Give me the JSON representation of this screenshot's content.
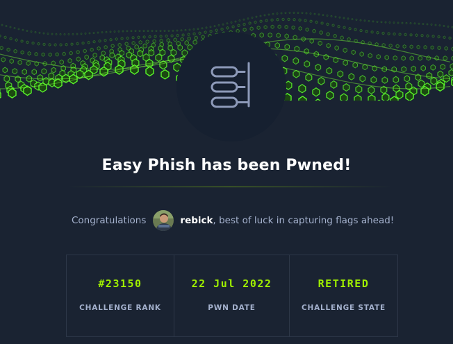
{
  "card": {
    "challenge_name": "Easy Phish",
    "title": "Easy Phish has been Pwned!",
    "congrats_prefix": "Congratulations",
    "username": "rebick",
    "congrats_suffix": ", best of luck in capturing flags ahead!"
  },
  "stats": [
    {
      "value": "#23150",
      "label": "CHALLENGE RANK"
    },
    {
      "value": "22 Jul 2022",
      "label": "PWN DATE"
    },
    {
      "value": "RETIRED",
      "label": "CHALLENGE STATE"
    }
  ],
  "icons": {
    "badge": "database-stack-icon",
    "avatar": "user-avatar"
  },
  "colors": {
    "background": "#1a2332",
    "accent": "#9fef00",
    "muted_text": "#a4b1cd",
    "title": "#ffffff"
  }
}
